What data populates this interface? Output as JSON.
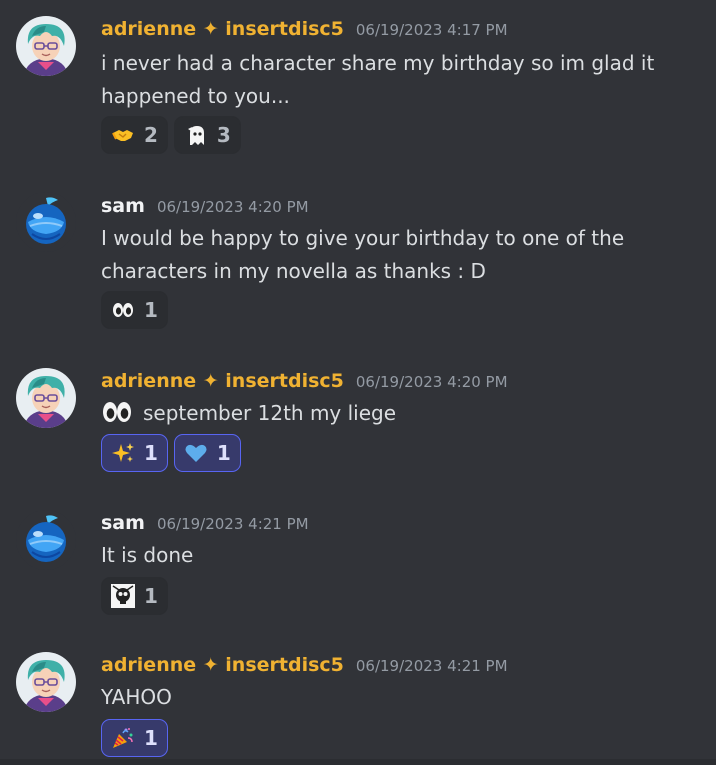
{
  "messages": [
    {
      "author": "adrienne ✦ insertdisc5",
      "timestamp": "06/19/2023 4:17 PM",
      "text": "i never had a character share my birthday so im glad it happened to you...",
      "reactions": [
        {
          "emoji": "handshake-emoji",
          "count": "2"
        },
        {
          "emoji": "custom-ghost-emoji",
          "count": "3"
        }
      ]
    },
    {
      "author": "sam",
      "timestamp": "06/19/2023 4:20 PM",
      "text": "I would be happy to give your birthday to one of the characters in my novella as thanks : D",
      "reactions": [
        {
          "emoji": "eyes-emoji",
          "count": "1"
        }
      ]
    },
    {
      "author": "adrienne ✦ insertdisc5",
      "timestamp": "06/19/2023 4:20 PM",
      "text": "september 12th my liege",
      "reactions": [
        {
          "emoji": "sparkles-emoji",
          "count": "1"
        },
        {
          "emoji": "blue-heart-emoji",
          "count": "1"
        }
      ]
    },
    {
      "author": "sam",
      "timestamp": "06/19/2023 4:21 PM",
      "text": "It is done",
      "reactions": [
        {
          "emoji": "custom-skull-emoji",
          "count": "1"
        }
      ]
    },
    {
      "author": "adrienne ✦ insertdisc5",
      "timestamp": "06/19/2023 4:21 PM",
      "text": "YAHOO",
      "reactions": [
        {
          "emoji": "party-popper-emoji",
          "count": "1"
        }
      ]
    }
  ],
  "colors": {
    "background": "#313338",
    "username_highlight": "#f0b232",
    "timestamp": "#949ba4",
    "reaction_bg": "#2b2d31",
    "reaction_active_bg": "#373a6b",
    "reaction_active_border": "#5865f2"
  }
}
